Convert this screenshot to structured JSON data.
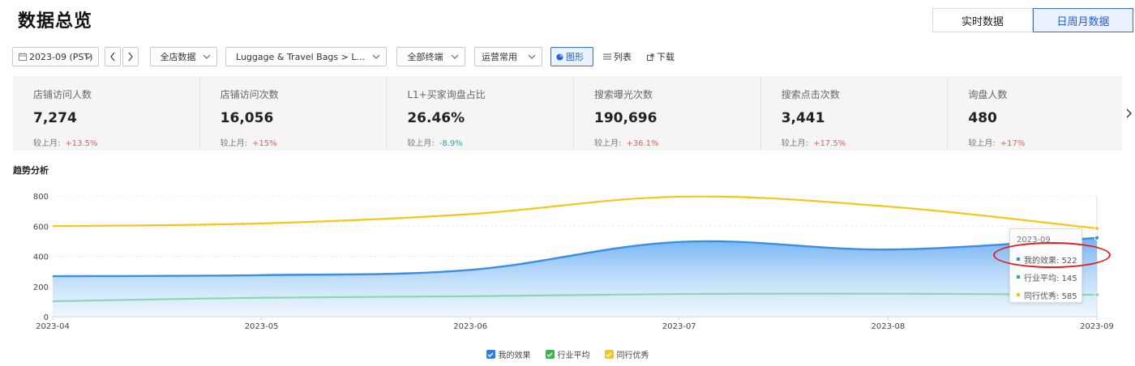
{
  "header": {
    "title": "数据总览"
  },
  "view_switch": {
    "realtime": "实时数据",
    "periodic": "日周月数据",
    "active": "periodic"
  },
  "toolbar": {
    "date": "2023-09 (PST)",
    "scope": "全店数据",
    "category": "Luggage & Travel Bags > L...",
    "terminal": "全部终端",
    "metric_group": "运营常用",
    "chart_view": "图形",
    "list_view": "列表",
    "download": "下载"
  },
  "metrics": [
    {
      "label": "店铺访问人数",
      "value": "7,274",
      "compare_label": "较上月:",
      "change": "+13.5%",
      "trend": "up"
    },
    {
      "label": "店铺访问次数",
      "value": "16,056",
      "compare_label": "较上月:",
      "change": "+15%",
      "trend": "up"
    },
    {
      "label": "L1+买家询盘占比",
      "value": "26.46%",
      "compare_label": "较上月:",
      "change": "-8.9%",
      "trend": "down"
    },
    {
      "label": "搜索曝光次数",
      "value": "190,696",
      "compare_label": "较上月:",
      "change": "+36.1%",
      "trend": "up"
    },
    {
      "label": "搜索点击次数",
      "value": "3,441",
      "compare_label": "较上月:",
      "change": "+17.5%",
      "trend": "up"
    },
    {
      "label": "询盘人数",
      "value": "480",
      "compare_label": "较上月:",
      "change": "+17%",
      "trend": "up"
    }
  ],
  "section": {
    "title": "趋势分析"
  },
  "tooltip": {
    "title": "2023-09",
    "rows": [
      {
        "label": "我的效果: 522",
        "color": "#3a8ee6"
      },
      {
        "label": "行业平均: 145",
        "color": "#2bb673"
      },
      {
        "label": "同行优秀: 585",
        "color": "#f5c518"
      }
    ]
  },
  "legend": [
    {
      "label": "我的效果",
      "color": "#2f7de1"
    },
    {
      "label": "行业平均",
      "color": "#3cb44b"
    },
    {
      "label": "同行优秀",
      "color": "#f2c230"
    }
  ],
  "chart_data": {
    "type": "area",
    "x": [
      "2023-04",
      "2023-05",
      "2023-06",
      "2023-07",
      "2023-08",
      "2023-09"
    ],
    "ylim": [
      0,
      800
    ],
    "yticks": [
      0,
      200,
      400,
      600,
      800
    ],
    "series": [
      {
        "name": "我的效果",
        "values": [
          268,
          275,
          310,
          495,
          445,
          522
        ],
        "color": "#3a8ee6",
        "fill": true
      },
      {
        "name": "行业平均",
        "values": [
          102,
          125,
          135,
          150,
          152,
          145
        ],
        "color": "#8fd6b0",
        "fill": false
      },
      {
        "name": "同行优秀",
        "values": [
          600,
          618,
          680,
          795,
          730,
          585
        ],
        "color": "#f5c518",
        "fill": false
      }
    ]
  }
}
